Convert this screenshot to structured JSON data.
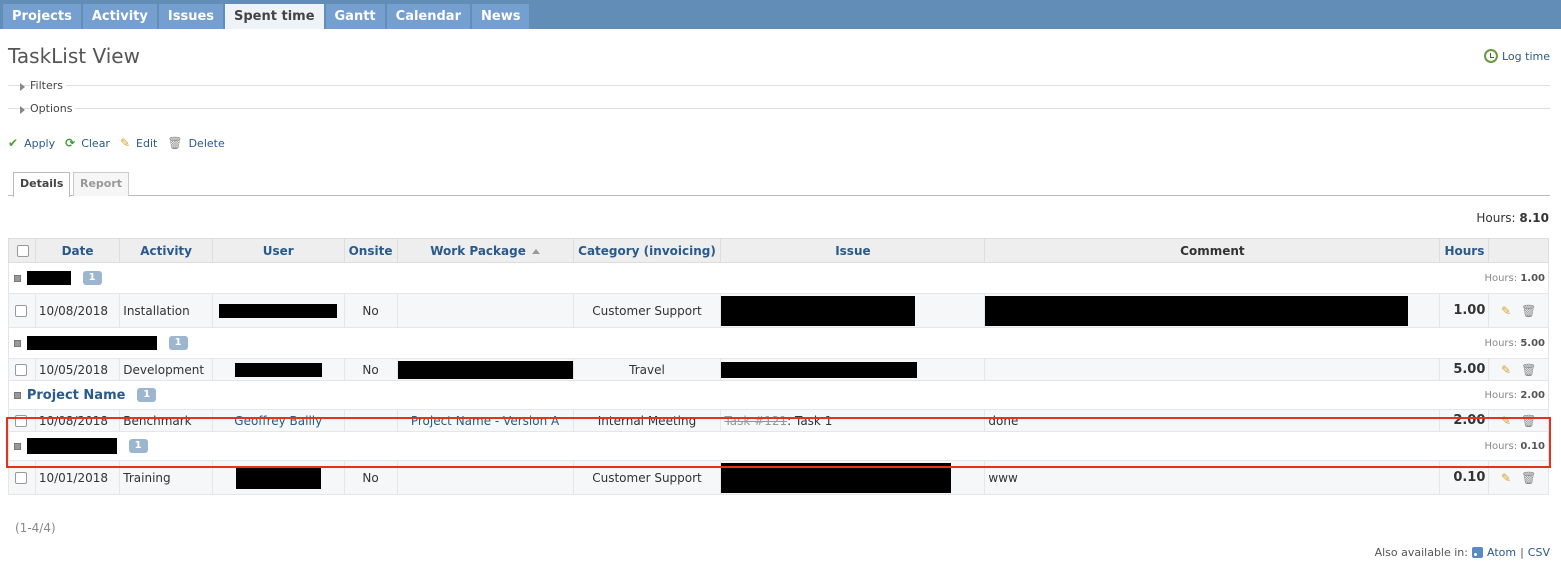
{
  "top_menu": [
    {
      "label": "Projects",
      "selected": false
    },
    {
      "label": "Activity",
      "selected": false
    },
    {
      "label": "Issues",
      "selected": false
    },
    {
      "label": "Spent time",
      "selected": true
    },
    {
      "label": "Gantt",
      "selected": false
    },
    {
      "label": "Calendar",
      "selected": false
    },
    {
      "label": "News",
      "selected": false
    }
  ],
  "page": {
    "title": "TaskList View",
    "log_time_label": "Log time",
    "filters_label": "Filters",
    "options_label": "Options"
  },
  "buttons": {
    "apply": "Apply",
    "clear": "Clear",
    "edit": "Edit",
    "delete": "Delete"
  },
  "tabs": {
    "details": "Details",
    "report": "Report"
  },
  "total": {
    "label": "Hours:",
    "value": "8.10"
  },
  "table": {
    "headers": {
      "date": "Date",
      "activity": "Activity",
      "user": "User",
      "onsite": "Onsite",
      "work_package": "Work Package",
      "category": "Category (invoicing)",
      "issue": "Issue",
      "comment": "Comment",
      "hours": "Hours"
    },
    "groups": [
      {
        "name": "",
        "count": "1",
        "hours_label": "Hours:",
        "hours": "1.00",
        "entry": {
          "date": "10/08/2018",
          "activity": "Installation",
          "user": "",
          "onsite": "No",
          "work_package": "",
          "category": "Customer Support",
          "issue_strike": "",
          "issue_text": "",
          "comment": "",
          "hours": "1.00"
        }
      },
      {
        "name": "",
        "count": "1",
        "hours_label": "Hours:",
        "hours": "5.00",
        "entry": {
          "date": "10/05/2018",
          "activity": "Development",
          "user": "",
          "onsite": "No",
          "work_package": "",
          "category": "Travel",
          "issue_strike": "",
          "issue_text": "",
          "comment": "",
          "hours": "5.00"
        }
      },
      {
        "name": "Project Name",
        "count": "1",
        "hours_label": "Hours:",
        "hours": "2.00",
        "entry": {
          "date": "10/08/2018",
          "activity": "Benchmark",
          "user": "Geoffrey Bailly",
          "onsite": "",
          "work_package": "Project Name - Version A",
          "category": "Internal Meeting",
          "issue_strike": "Task #121",
          "issue_text": ": Task 1",
          "comment": "done",
          "hours": "2.00"
        }
      },
      {
        "name": "",
        "count": "1",
        "hours_label": "Hours:",
        "hours": "0.10",
        "entry": {
          "date": "10/01/2018",
          "activity": "Training",
          "user": "",
          "onsite": "No",
          "work_package": "",
          "category": "Customer Support",
          "issue_strike": "",
          "issue_text": "",
          "comment": "www",
          "hours": "0.10"
        }
      }
    ]
  },
  "pagination": "(1-4/4)",
  "other_formats": {
    "label": "Also available in:",
    "atom": "Atom",
    "csv": "CSV"
  }
}
